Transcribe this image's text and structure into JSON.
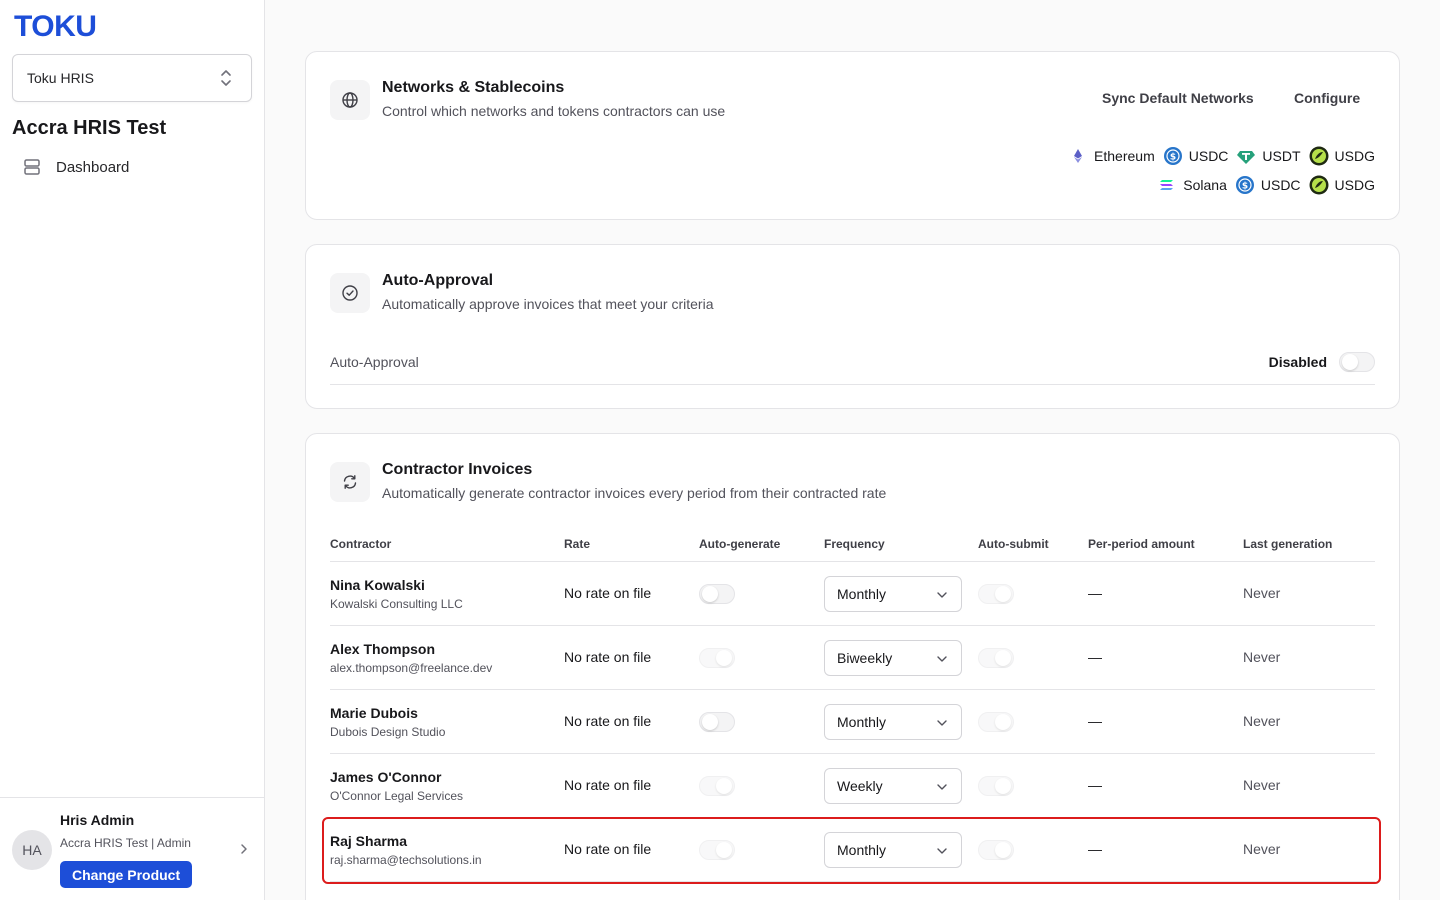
{
  "brand": {
    "logo": "TOKU",
    "accent": "#1d4ed8"
  },
  "sidebar": {
    "product_selector": "Toku HRIS",
    "org_name": "Accra HRIS Test",
    "nav": [
      {
        "label": "Dashboard",
        "icon": "dashboard-icon"
      }
    ],
    "user": {
      "initials": "HA",
      "name": "Hris Admin",
      "meta": "Accra HRIS Test | Admin",
      "change_label": "Change Product"
    }
  },
  "networks": {
    "title": "Networks & Stablecoins",
    "description": "Control which networks and tokens contractors can use",
    "sync_label": "Sync Default Networks",
    "configure_label": "Configure",
    "rows": [
      {
        "network": "Ethereum",
        "tokens": [
          "USDC",
          "USDT",
          "USDG"
        ]
      },
      {
        "network": "Solana",
        "tokens": [
          "USDC",
          "USDG"
        ]
      }
    ]
  },
  "approval": {
    "title": "Auto-Approval",
    "description": "Automatically approve invoices that meet your criteria",
    "row_label": "Auto-Approval",
    "state": "Disabled"
  },
  "invoices": {
    "title": "Contractor Invoices",
    "description": "Automatically generate contractor invoices every period from their contracted rate",
    "columns": [
      "Contractor",
      "Rate",
      "Auto-generate",
      "Frequency",
      "Auto-submit",
      "Per-period amount",
      "Last generation"
    ],
    "rows": [
      {
        "name": "Nina Kowalski",
        "sub": "Kowalski Consulting LLC",
        "rate": "No rate on file",
        "frequency": "Monthly",
        "amount": "—",
        "last": "Never"
      },
      {
        "name": "Alex Thompson",
        "sub": "alex.thompson@freelance.dev",
        "rate": "No rate on file",
        "frequency": "Biweekly",
        "amount": "—",
        "last": "Never"
      },
      {
        "name": "Marie Dubois",
        "sub": "Dubois Design Studio",
        "rate": "No rate on file",
        "frequency": "Monthly",
        "amount": "—",
        "last": "Never"
      },
      {
        "name": "James O'Connor",
        "sub": "O'Connor Legal Services",
        "rate": "No rate on file",
        "frequency": "Weekly",
        "amount": "—",
        "last": "Never"
      },
      {
        "name": "Raj Sharma",
        "sub": "raj.sharma@techsolutions.in",
        "rate": "No rate on file",
        "frequency": "Monthly",
        "amount": "—",
        "last": "Never"
      }
    ]
  }
}
